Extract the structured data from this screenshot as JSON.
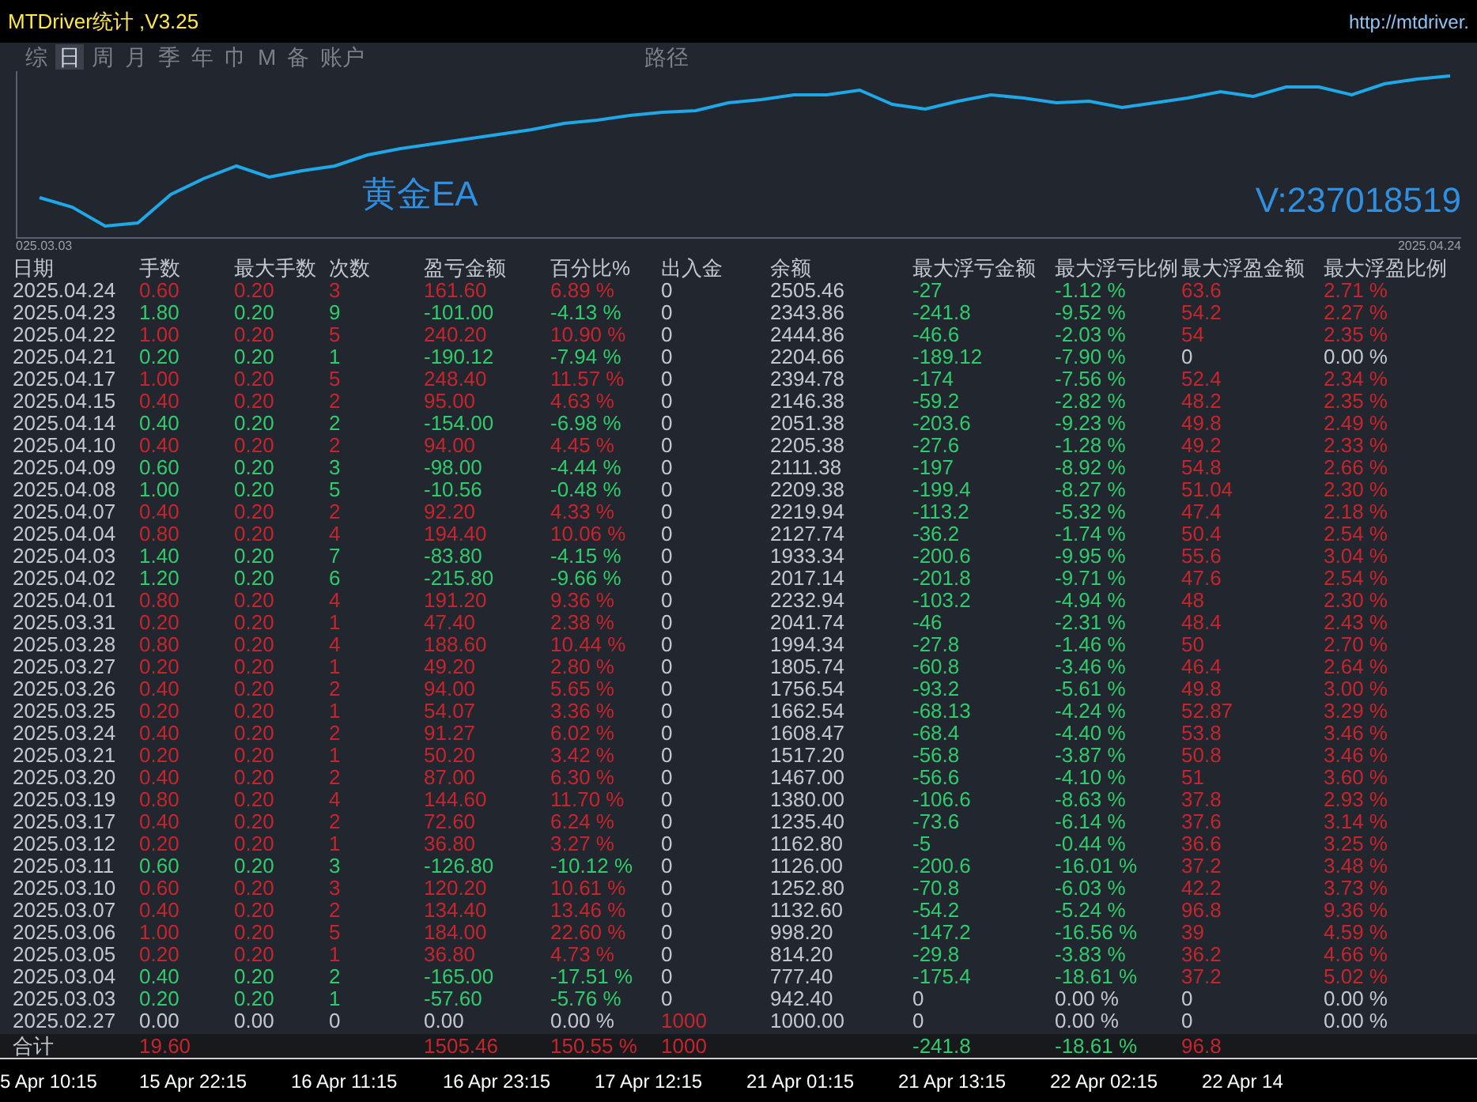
{
  "window": {
    "title": "MTDriver统计 ,V3.25",
    "url": "http://mtdriver."
  },
  "tabs": [
    {
      "label": "综",
      "selected": false
    },
    {
      "label": "日",
      "selected": true
    },
    {
      "label": "周",
      "selected": false
    },
    {
      "label": "月",
      "selected": false
    },
    {
      "label": "季",
      "selected": false
    },
    {
      "label": "年",
      "selected": false
    },
    {
      "label": "巾",
      "selected": false
    },
    {
      "label": "M",
      "selected": false
    },
    {
      "label": "备",
      "selected": false
    },
    {
      "label": "账户",
      "selected": false
    },
    {
      "label": "路径",
      "selected": false
    }
  ],
  "chart": {
    "start_label": "025.03.03",
    "end_label": "2025.04.24",
    "name": "黄金EA",
    "account": "V:237018519"
  },
  "table": {
    "columns": [
      "日期",
      "手数",
      "最大手数",
      "次数",
      "盈亏金额",
      "百分比%",
      "出入金",
      "余额",
      "最大浮亏金额",
      "最大浮亏比例",
      "最大浮盈金额",
      "最大浮盈比例"
    ],
    "rows": [
      {
        "date": "2025.04.24",
        "kind": "profit",
        "values": [
          "0.60",
          "0.20",
          "3",
          "161.60",
          "6.89 %"
        ],
        "cash": {
          "value": "0",
          "kind": "flat"
        },
        "balance": "2505.46",
        "float_loss": {
          "amount": "-27",
          "pct": "-1.12 %",
          "kind": "loss"
        },
        "float_profit": {
          "amount": "63.6",
          "pct": "2.71 %",
          "kind": "profit"
        }
      },
      {
        "date": "2025.04.23",
        "kind": "loss",
        "values": [
          "1.80",
          "0.20",
          "9",
          "-101.00",
          "-4.13 %"
        ],
        "cash": {
          "value": "0",
          "kind": "flat"
        },
        "balance": "2343.86",
        "float_loss": {
          "amount": "-241.8",
          "pct": "-9.52 %",
          "kind": "loss"
        },
        "float_profit": {
          "amount": "54.2",
          "pct": "2.27 %",
          "kind": "profit"
        }
      },
      {
        "date": "2025.04.22",
        "kind": "profit",
        "values": [
          "1.00",
          "0.20",
          "5",
          "240.20",
          "10.90 %"
        ],
        "cash": {
          "value": "0",
          "kind": "flat"
        },
        "balance": "2444.86",
        "float_loss": {
          "amount": "-46.6",
          "pct": "-2.03 %",
          "kind": "loss"
        },
        "float_profit": {
          "amount": "54",
          "pct": "2.35 %",
          "kind": "profit"
        }
      },
      {
        "date": "2025.04.21",
        "kind": "loss",
        "values": [
          "0.20",
          "0.20",
          "1",
          "-190.12",
          "-7.94 %"
        ],
        "cash": {
          "value": "0",
          "kind": "flat"
        },
        "balance": "2204.66",
        "float_loss": {
          "amount": "-189.12",
          "pct": "-7.90 %",
          "kind": "loss"
        },
        "float_profit": {
          "amount": "0",
          "pct": "0.00 %",
          "kind": "flat"
        }
      },
      {
        "date": "2025.04.17",
        "kind": "profit",
        "values": [
          "1.00",
          "0.20",
          "5",
          "248.40",
          "11.57 %"
        ],
        "cash": {
          "value": "0",
          "kind": "flat"
        },
        "balance": "2394.78",
        "float_loss": {
          "amount": "-174",
          "pct": "-7.56 %",
          "kind": "loss"
        },
        "float_profit": {
          "amount": "52.4",
          "pct": "2.34 %",
          "kind": "profit"
        }
      },
      {
        "date": "2025.04.15",
        "kind": "profit",
        "values": [
          "0.40",
          "0.20",
          "2",
          "95.00",
          "4.63 %"
        ],
        "cash": {
          "value": "0",
          "kind": "flat"
        },
        "balance": "2146.38",
        "float_loss": {
          "amount": "-59.2",
          "pct": "-2.82 %",
          "kind": "loss"
        },
        "float_profit": {
          "amount": "48.2",
          "pct": "2.35 %",
          "kind": "profit"
        }
      },
      {
        "date": "2025.04.14",
        "kind": "loss",
        "values": [
          "0.40",
          "0.20",
          "2",
          "-154.00",
          "-6.98 %"
        ],
        "cash": {
          "value": "0",
          "kind": "flat"
        },
        "balance": "2051.38",
        "float_loss": {
          "amount": "-203.6",
          "pct": "-9.23 %",
          "kind": "loss"
        },
        "float_profit": {
          "amount": "49.8",
          "pct": "2.49 %",
          "kind": "profit"
        }
      },
      {
        "date": "2025.04.10",
        "kind": "profit",
        "values": [
          "0.40",
          "0.20",
          "2",
          "94.00",
          "4.45 %"
        ],
        "cash": {
          "value": "0",
          "kind": "flat"
        },
        "balance": "2205.38",
        "float_loss": {
          "amount": "-27.6",
          "pct": "-1.28 %",
          "kind": "loss"
        },
        "float_profit": {
          "amount": "49.2",
          "pct": "2.33 %",
          "kind": "profit"
        }
      },
      {
        "date": "2025.04.09",
        "kind": "loss",
        "values": [
          "0.60",
          "0.20",
          "3",
          "-98.00",
          "-4.44 %"
        ],
        "cash": {
          "value": "0",
          "kind": "flat"
        },
        "balance": "2111.38",
        "float_loss": {
          "amount": "-197",
          "pct": "-8.92 %",
          "kind": "loss"
        },
        "float_profit": {
          "amount": "54.8",
          "pct": "2.66 %",
          "kind": "profit"
        }
      },
      {
        "date": "2025.04.08",
        "kind": "loss",
        "values": [
          "1.00",
          "0.20",
          "5",
          "-10.56",
          "-0.48 %"
        ],
        "cash": {
          "value": "0",
          "kind": "flat"
        },
        "balance": "2209.38",
        "float_loss": {
          "amount": "-199.4",
          "pct": "-8.27 %",
          "kind": "loss"
        },
        "float_profit": {
          "amount": "51.04",
          "pct": "2.30 %",
          "kind": "profit"
        }
      },
      {
        "date": "2025.04.07",
        "kind": "profit",
        "values": [
          "0.40",
          "0.20",
          "2",
          "92.20",
          "4.33 %"
        ],
        "cash": {
          "value": "0",
          "kind": "flat"
        },
        "balance": "2219.94",
        "float_loss": {
          "amount": "-113.2",
          "pct": "-5.32 %",
          "kind": "loss"
        },
        "float_profit": {
          "amount": "47.4",
          "pct": "2.18 %",
          "kind": "profit"
        }
      },
      {
        "date": "2025.04.04",
        "kind": "profit",
        "values": [
          "0.80",
          "0.20",
          "4",
          "194.40",
          "10.06 %"
        ],
        "cash": {
          "value": "0",
          "kind": "flat"
        },
        "balance": "2127.74",
        "float_loss": {
          "amount": "-36.2",
          "pct": "-1.74 %",
          "kind": "loss"
        },
        "float_profit": {
          "amount": "50.4",
          "pct": "2.54 %",
          "kind": "profit"
        }
      },
      {
        "date": "2025.04.03",
        "kind": "loss",
        "values": [
          "1.40",
          "0.20",
          "7",
          "-83.80",
          "-4.15 %"
        ],
        "cash": {
          "value": "0",
          "kind": "flat"
        },
        "balance": "1933.34",
        "float_loss": {
          "amount": "-200.6",
          "pct": "-9.95 %",
          "kind": "loss"
        },
        "float_profit": {
          "amount": "55.6",
          "pct": "3.04 %",
          "kind": "profit"
        }
      },
      {
        "date": "2025.04.02",
        "kind": "loss",
        "values": [
          "1.20",
          "0.20",
          "6",
          "-215.80",
          "-9.66 %"
        ],
        "cash": {
          "value": "0",
          "kind": "flat"
        },
        "balance": "2017.14",
        "float_loss": {
          "amount": "-201.8",
          "pct": "-9.71 %",
          "kind": "loss"
        },
        "float_profit": {
          "amount": "47.6",
          "pct": "2.54 %",
          "kind": "profit"
        }
      },
      {
        "date": "2025.04.01",
        "kind": "profit",
        "values": [
          "0.80",
          "0.20",
          "4",
          "191.20",
          "9.36 %"
        ],
        "cash": {
          "value": "0",
          "kind": "flat"
        },
        "balance": "2232.94",
        "float_loss": {
          "amount": "-103.2",
          "pct": "-4.94 %",
          "kind": "loss"
        },
        "float_profit": {
          "amount": "48",
          "pct": "2.30 %",
          "kind": "profit"
        }
      },
      {
        "date": "2025.03.31",
        "kind": "profit",
        "values": [
          "0.20",
          "0.20",
          "1",
          "47.40",
          "2.38 %"
        ],
        "cash": {
          "value": "0",
          "kind": "flat"
        },
        "balance": "2041.74",
        "float_loss": {
          "amount": "-46",
          "pct": "-2.31 %",
          "kind": "loss"
        },
        "float_profit": {
          "amount": "48.4",
          "pct": "2.43 %",
          "kind": "profit"
        }
      },
      {
        "date": "2025.03.28",
        "kind": "profit",
        "values": [
          "0.80",
          "0.20",
          "4",
          "188.60",
          "10.44 %"
        ],
        "cash": {
          "value": "0",
          "kind": "flat"
        },
        "balance": "1994.34",
        "float_loss": {
          "amount": "-27.8",
          "pct": "-1.46 %",
          "kind": "loss"
        },
        "float_profit": {
          "amount": "50",
          "pct": "2.70 %",
          "kind": "profit"
        }
      },
      {
        "date": "2025.03.27",
        "kind": "profit",
        "values": [
          "0.20",
          "0.20",
          "1",
          "49.20",
          "2.80 %"
        ],
        "cash": {
          "value": "0",
          "kind": "flat"
        },
        "balance": "1805.74",
        "float_loss": {
          "amount": "-60.8",
          "pct": "-3.46 %",
          "kind": "loss"
        },
        "float_profit": {
          "amount": "46.4",
          "pct": "2.64 %",
          "kind": "profit"
        }
      },
      {
        "date": "2025.03.26",
        "kind": "profit",
        "values": [
          "0.40",
          "0.20",
          "2",
          "94.00",
          "5.65 %"
        ],
        "cash": {
          "value": "0",
          "kind": "flat"
        },
        "balance": "1756.54",
        "float_loss": {
          "amount": "-93.2",
          "pct": "-5.61 %",
          "kind": "loss"
        },
        "float_profit": {
          "amount": "49.8",
          "pct": "3.00 %",
          "kind": "profit"
        }
      },
      {
        "date": "2025.03.25",
        "kind": "profit",
        "values": [
          "0.20",
          "0.20",
          "1",
          "54.07",
          "3.36 %"
        ],
        "cash": {
          "value": "0",
          "kind": "flat"
        },
        "balance": "1662.54",
        "float_loss": {
          "amount": "-68.13",
          "pct": "-4.24 %",
          "kind": "loss"
        },
        "float_profit": {
          "amount": "52.87",
          "pct": "3.29 %",
          "kind": "profit"
        }
      },
      {
        "date": "2025.03.24",
        "kind": "profit",
        "values": [
          "0.40",
          "0.20",
          "2",
          "91.27",
          "6.02 %"
        ],
        "cash": {
          "value": "0",
          "kind": "flat"
        },
        "balance": "1608.47",
        "float_loss": {
          "amount": "-68.4",
          "pct": "-4.40 %",
          "kind": "loss"
        },
        "float_profit": {
          "amount": "53.8",
          "pct": "3.46 %",
          "kind": "profit"
        }
      },
      {
        "date": "2025.03.21",
        "kind": "profit",
        "values": [
          "0.20",
          "0.20",
          "1",
          "50.20",
          "3.42 %"
        ],
        "cash": {
          "value": "0",
          "kind": "flat"
        },
        "balance": "1517.20",
        "float_loss": {
          "amount": "-56.8",
          "pct": "-3.87 %",
          "kind": "loss"
        },
        "float_profit": {
          "amount": "50.8",
          "pct": "3.46 %",
          "kind": "profit"
        }
      },
      {
        "date": "2025.03.20",
        "kind": "profit",
        "values": [
          "0.40",
          "0.20",
          "2",
          "87.00",
          "6.30 %"
        ],
        "cash": {
          "value": "0",
          "kind": "flat"
        },
        "balance": "1467.00",
        "float_loss": {
          "amount": "-56.6",
          "pct": "-4.10 %",
          "kind": "loss"
        },
        "float_profit": {
          "amount": "51",
          "pct": "3.60 %",
          "kind": "profit"
        }
      },
      {
        "date": "2025.03.19",
        "kind": "profit",
        "values": [
          "0.80",
          "0.20",
          "4",
          "144.60",
          "11.70 %"
        ],
        "cash": {
          "value": "0",
          "kind": "flat"
        },
        "balance": "1380.00",
        "float_loss": {
          "amount": "-106.6",
          "pct": "-8.63 %",
          "kind": "loss"
        },
        "float_profit": {
          "amount": "37.8",
          "pct": "2.93 %",
          "kind": "profit"
        }
      },
      {
        "date": "2025.03.17",
        "kind": "profit",
        "values": [
          "0.40",
          "0.20",
          "2",
          "72.60",
          "6.24 %"
        ],
        "cash": {
          "value": "0",
          "kind": "flat"
        },
        "balance": "1235.40",
        "float_loss": {
          "amount": "-73.6",
          "pct": "-6.14 %",
          "kind": "loss"
        },
        "float_profit": {
          "amount": "37.6",
          "pct": "3.14 %",
          "kind": "profit"
        }
      },
      {
        "date": "2025.03.12",
        "kind": "profit",
        "values": [
          "0.20",
          "0.20",
          "1",
          "36.80",
          "3.27 %"
        ],
        "cash": {
          "value": "0",
          "kind": "flat"
        },
        "balance": "1162.80",
        "float_loss": {
          "amount": "-5",
          "pct": "-0.44 %",
          "kind": "loss"
        },
        "float_profit": {
          "amount": "36.6",
          "pct": "3.25 %",
          "kind": "profit"
        }
      },
      {
        "date": "2025.03.11",
        "kind": "loss",
        "values": [
          "0.60",
          "0.20",
          "3",
          "-126.80",
          "-10.12 %"
        ],
        "cash": {
          "value": "0",
          "kind": "flat"
        },
        "balance": "1126.00",
        "float_loss": {
          "amount": "-200.6",
          "pct": "-16.01 %",
          "kind": "loss"
        },
        "float_profit": {
          "amount": "37.2",
          "pct": "3.48 %",
          "kind": "profit"
        }
      },
      {
        "date": "2025.03.10",
        "kind": "profit",
        "values": [
          "0.60",
          "0.20",
          "3",
          "120.20",
          "10.61 %"
        ],
        "cash": {
          "value": "0",
          "kind": "flat"
        },
        "balance": "1252.80",
        "float_loss": {
          "amount": "-70.8",
          "pct": "-6.03 %",
          "kind": "loss"
        },
        "float_profit": {
          "amount": "42.2",
          "pct": "3.73 %",
          "kind": "profit"
        }
      },
      {
        "date": "2025.03.07",
        "kind": "profit",
        "values": [
          "0.40",
          "0.20",
          "2",
          "134.40",
          "13.46 %"
        ],
        "cash": {
          "value": "0",
          "kind": "flat"
        },
        "balance": "1132.60",
        "float_loss": {
          "amount": "-54.2",
          "pct": "-5.24 %",
          "kind": "loss"
        },
        "float_profit": {
          "amount": "96.8",
          "pct": "9.36 %",
          "kind": "profit"
        }
      },
      {
        "date": "2025.03.06",
        "kind": "profit",
        "values": [
          "1.00",
          "0.20",
          "5",
          "184.00",
          "22.60 %"
        ],
        "cash": {
          "value": "0",
          "kind": "flat"
        },
        "balance": "998.20",
        "float_loss": {
          "amount": "-147.2",
          "pct": "-16.56 %",
          "kind": "loss"
        },
        "float_profit": {
          "amount": "39",
          "pct": "4.59 %",
          "kind": "profit"
        }
      },
      {
        "date": "2025.03.05",
        "kind": "profit",
        "values": [
          "0.20",
          "0.20",
          "1",
          "36.80",
          "4.73 %"
        ],
        "cash": {
          "value": "0",
          "kind": "flat"
        },
        "balance": "814.20",
        "float_loss": {
          "amount": "-29.8",
          "pct": "-3.83 %",
          "kind": "loss"
        },
        "float_profit": {
          "amount": "36.2",
          "pct": "4.66 %",
          "kind": "profit"
        }
      },
      {
        "date": "2025.03.04",
        "kind": "loss",
        "values": [
          "0.40",
          "0.20",
          "2",
          "-165.00",
          "-17.51 %"
        ],
        "cash": {
          "value": "0",
          "kind": "flat"
        },
        "balance": "777.40",
        "float_loss": {
          "amount": "-175.4",
          "pct": "-18.61 %",
          "kind": "loss"
        },
        "float_profit": {
          "amount": "37.2",
          "pct": "5.02 %",
          "kind": "profit"
        }
      },
      {
        "date": "2025.03.03",
        "kind": "loss",
        "values": [
          "0.20",
          "0.20",
          "1",
          "-57.60",
          "-5.76 %"
        ],
        "cash": {
          "value": "0",
          "kind": "flat"
        },
        "balance": "942.40",
        "float_loss": {
          "amount": "0",
          "pct": "0.00 %",
          "kind": "flat"
        },
        "float_profit": {
          "amount": "0",
          "pct": "0.00 %",
          "kind": "flat"
        }
      },
      {
        "date": "2025.02.27",
        "kind": "flat",
        "values": [
          "0.00",
          "0.00",
          "0",
          "0.00",
          "0.00 %"
        ],
        "cash": {
          "value": "1000",
          "kind": "profit"
        },
        "balance": "1000.00",
        "float_loss": {
          "amount": "0",
          "pct": "0.00 %",
          "kind": "flat"
        },
        "float_profit": {
          "amount": "0",
          "pct": "0.00 %",
          "kind": "flat"
        }
      }
    ],
    "total": {
      "label": "合计",
      "lots": "19.60",
      "pnl": "1505.46",
      "pct": "150.55 %",
      "cash": "1000",
      "max_float_loss": "-241.8",
      "max_float_loss_pct": "-18.61 %",
      "max_float_profit": "96.8"
    }
  },
  "time_axis": [
    "5 Apr 10:15",
    "15 Apr 22:15",
    "16 Apr 11:15",
    "16 Apr 23:15",
    "17 Apr 12:15",
    "21 Apr 01:15",
    "21 Apr 13:15",
    "22 Apr 02:15",
    "22 Apr 14"
  ]
}
